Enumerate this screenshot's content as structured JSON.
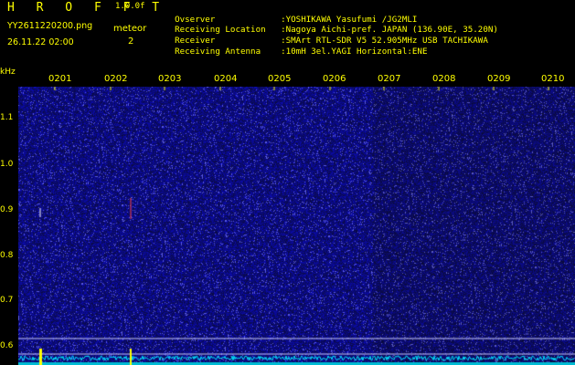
{
  "header": {
    "title": "H R O F F T",
    "version": "1.0.0f",
    "filename": "YY2611220200.png",
    "datetime": "26.11.22 02:00",
    "meteor_label": "meteor",
    "meteor_count": "2"
  },
  "info": {
    "rows": [
      {
        "label": "Ovserver",
        "value": ":YOSHIKAWA Yasufumi /JG2MLI"
      },
      {
        "label": "Receiving Location",
        "value": ":Nagoya Aichi-pref. JAPAN (136.90E, 35.20N)"
      },
      {
        "label": "Receiver",
        "value": ":SMArt RTL-SDR V5 52.905MHz USB TACHIKAWA"
      },
      {
        "label": "Receiving Antenna",
        "value": ":10mH 3el.YAGI Horizontal:ENE"
      }
    ]
  },
  "axes": {
    "y_unit": "kHz",
    "y_ticks": [
      "1.1",
      "1.0",
      "0.9",
      "0.8",
      "0.7",
      "0.6"
    ],
    "x_ticks": [
      "0201",
      "0202",
      "0203",
      "0204",
      "0205",
      "0206",
      "0207",
      "0208",
      "0209",
      "0210"
    ]
  },
  "colors": {
    "text": "#ffff00",
    "background": "#000000",
    "noise_base": "#0a0a6e",
    "trace": "#00e5ff",
    "marker": "#ffff00"
  }
}
